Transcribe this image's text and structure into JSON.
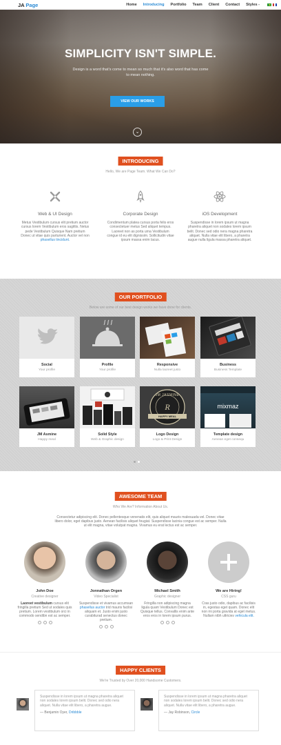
{
  "header": {
    "logo_main": "JA",
    "logo_accent": "Page",
    "nav": [
      "Home",
      "Introducing",
      "Portfolio",
      "Team",
      "Client",
      "Contact",
      "Styles -"
    ]
  },
  "hero": {
    "title": "SIMPLICITY ISN'T SIMPLE.",
    "subtitle": "Design is a word that's come to mean so much that it's also word that has come to mean nothing.",
    "button": "VIEW OUR WORKS"
  },
  "introducing": {
    "label": "INTRODUCING",
    "subtitle": "Hello, We are Page Team. What We Can Do?",
    "columns": [
      {
        "icon": "tools-icon",
        "title": "Web & UI Design",
        "text": "Metus Vestibulum cursus elit pretium auctor cursus lorem Vestibulum eros sagittis. Netus pede Vestibulum Quisque Nam pretium Donec ut vitae quis parturient. Auctor vel non",
        "link": "phasellus tincidunt."
      },
      {
        "icon": "rocket-icon",
        "title": "Corporate Design",
        "text": "Condimentum platea cursus porta felis eros consectetuer metus Sed aliquet tempus. Laoreet non as porta urna Vestibulum congue id eu elit dignissim. Sollicitudin vitae ipsum massa enim lacus.",
        "link": ""
      },
      {
        "icon": "atom-icon",
        "title": "iOS Development",
        "text": "Suspendisse in lorem ipsum ut magna pharetra aliquet non sodales lorem ipsum belit. Donec sed odio nera magna pharetra aliquet. Nulla vitae elit libero, a pharetra augue nulla ligula massa pharetra aliquet.",
        "link": ""
      }
    ]
  },
  "portfolio": {
    "label": "OUR PORTFOLIO",
    "subtitle": "Below are some of our best design works we have done for clients.",
    "items": [
      {
        "title": "Social",
        "sub": "Your profile"
      },
      {
        "title": "Profile",
        "sub": "Your profile"
      },
      {
        "title": "Responsive",
        "sub": "Nulla laoreet justo"
      },
      {
        "title": "Business",
        "sub": "Business Template"
      },
      {
        "title": "JM Asmine",
        "sub": "Happy meal"
      },
      {
        "title": "Solid Style",
        "sub": "Web & Graphic design"
      },
      {
        "title": "Logo Design",
        "sub": "Logo & Print Design"
      },
      {
        "title": "Template design",
        "sub": "Aenean eget consequ"
      }
    ],
    "badge_jasmine": "JM JASMINE",
    "badge_happy": "HAPPY MEAL",
    "mixmaz": "mixmaz"
  },
  "team": {
    "label": "AWESOME TEAM",
    "subtitle": "Who We Are? Information About Us.",
    "description": "Consectetur adipiscing elit. Donec pellentesque venenatis elit, quis aliquet mauris malesuada vel. Donec vitae libero dolor, eget dapibus justo. Aenean facilisis aliquet feugiat. Suspendisse lacinia congue est ac semper. Nulla ut elit magna, vitae volutpat magna. Vivamus eu erat lectus est ac semper.",
    "members": [
      {
        "name": "John Doe",
        "role": "Creative designer",
        "bold": "Laoreet vestibulum",
        "bio": "cursus elit fringilla pretium Sed ut sodales quis pretium. Lorem vestibulum orci in commodo sendibn est ac semper.",
        "link": ""
      },
      {
        "name": "Jonnathan Orgen",
        "role": "Video Specialist",
        "bold": "",
        "bio": "Suspendisse et vivamus accumsan",
        "link": "phasellus auctor",
        "bio2": "trid mauris facilisi aliquam et. Justo enim justo curabiturad senectus donec pretium."
      },
      {
        "name": "Michael Smith",
        "role": "Graphic designer",
        "bold": "",
        "bio": "Fringilla non adipiscing magna ligula quam Vestibulum Donec est Quisque tellus. Convallis enim ante eros eros in lorem ipsum purus.",
        "link": ""
      },
      {
        "name": "We are Hiring!",
        "role": "CSS guru",
        "bold": "",
        "bio": "Cras justo odio, dapibus ac facilisis in, egestas eget quam. Donec elit non mi porta gravida at eget metus. Nullam nibh ultricies",
        "link": "vehicula elit."
      }
    ]
  },
  "clients": {
    "label": "HAPPY CLIENTS",
    "subtitle": "We're Trusted by Over 20,000 Handsome Customers.",
    "quotes": [
      {
        "text": "Suspendisse in lorem ipsum ut magna pharetra aliquet non sodales lorem ipsum belit. Donec sed odio nera aliquet. Nulla vitae elit libero, a pharetra augue.",
        "author": "— Benjamin Oyer,",
        "company": "Dribbble"
      },
      {
        "text": "Suspendisse in lorem ipsum ut magna pharetra aliquet non sodales lorem ipsum belit. Donec sed odio nera aliquet. Nulla vitae elit libero, a pharetra augue.",
        "author": "— Jay Robinson,",
        "company": "Circle"
      }
    ]
  }
}
